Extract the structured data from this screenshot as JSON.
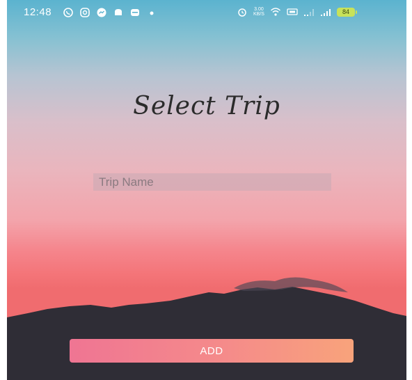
{
  "status_bar": {
    "time": "12:48",
    "left_icons": [
      "whatsapp-icon",
      "instagram-icon",
      "messenger-icon",
      "notification-icon",
      "message-icon",
      "dot-icon"
    ],
    "right_icons": [
      "alarm-icon",
      "wifi-icon",
      "volte-icon",
      "signal-weak-icon",
      "signal-icon"
    ],
    "net_speed_value": "3.00",
    "net_speed_unit": "KB/S",
    "battery_level": "84"
  },
  "screen": {
    "title": "Select Trip",
    "trip_name_placeholder": "Trip Name",
    "trip_name_value": "",
    "add_label": "ADD"
  },
  "colors": {
    "sky_top": "#5bb3cf",
    "sky_bottom": "#f06c6f",
    "mountain": "#2f2d36",
    "button_start": "#ef7593",
    "button_end": "#f8a37b"
  }
}
